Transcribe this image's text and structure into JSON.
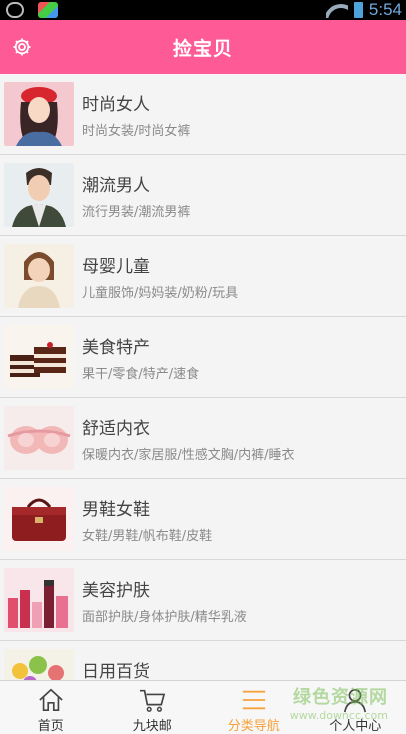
{
  "status_bar": {
    "time": "5:54"
  },
  "header": {
    "title": "捡宝贝"
  },
  "categories": [
    {
      "title": "时尚女人",
      "subtitle": "时尚女装/时尚女裤",
      "thumb": "fashion-woman"
    },
    {
      "title": "潮流男人",
      "subtitle": "流行男装/潮流男裤",
      "thumb": "fashion-man"
    },
    {
      "title": "母婴儿童",
      "subtitle": "儿童服饰/妈妈装/奶粉/玩具",
      "thumb": "child"
    },
    {
      "title": "美食特产",
      "subtitle": "果干/零食/特产/速食",
      "thumb": "cake"
    },
    {
      "title": "舒适内衣",
      "subtitle": "保暖内衣/家居服/性感文胸/内裤/睡衣",
      "thumb": "bra"
    },
    {
      "title": "男鞋女鞋",
      "subtitle": "女鞋/男鞋/帆布鞋/皮鞋",
      "thumb": "handbag"
    },
    {
      "title": "美容护肤",
      "subtitle": "面部护肤/身体护肤/精华乳液",
      "thumb": "cosmetics"
    },
    {
      "title": "日用百货",
      "subtitle": "",
      "thumb": "flowers"
    }
  ],
  "bottom_nav": [
    {
      "label": "首页",
      "icon": "home-icon"
    },
    {
      "label": "九块邮",
      "icon": "cart-icon"
    },
    {
      "label": "分类导航",
      "icon": "list-icon",
      "active": true
    },
    {
      "label": "个人中心",
      "icon": "user-icon"
    }
  ],
  "watermark": {
    "main": "绿色资源网",
    "sub": "www.downcc.com"
  }
}
